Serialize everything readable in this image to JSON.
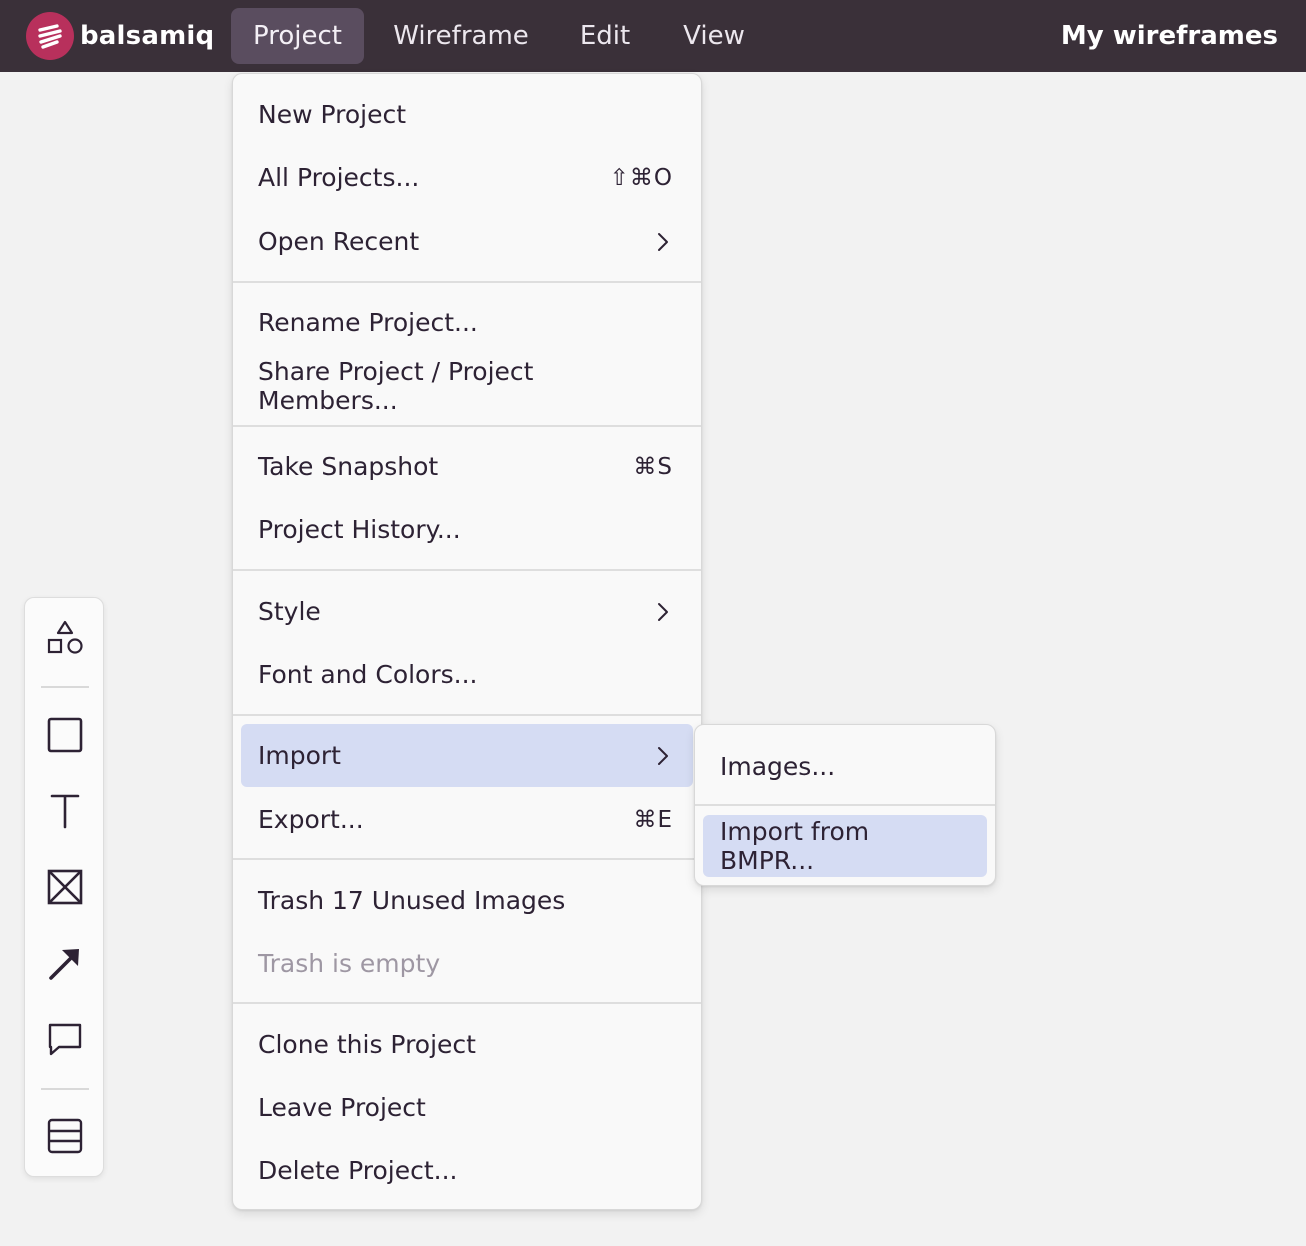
{
  "app": {
    "logo_text": "balsamiq",
    "right_link": "My wireframes"
  },
  "nav": [
    "Project",
    "Wireframe",
    "Edit",
    "View"
  ],
  "project_menu": {
    "new_project": "New Project",
    "all_projects": "All Projects...",
    "all_projects_shortcut": "⇧⌘O",
    "open_recent": "Open Recent",
    "rename_project": "Rename Project...",
    "share_project": "Share Project / Project Members...",
    "take_snapshot": "Take Snapshot",
    "take_snapshot_shortcut": "⌘S",
    "project_history": "Project History...",
    "style": "Style",
    "font_colors": "Font and Colors...",
    "import": "Import",
    "export": "Export...",
    "export_shortcut": "⌘E",
    "trash_unused": "Trash 17 Unused Images",
    "trash_empty": "Trash is empty",
    "clone_project": "Clone this Project",
    "leave_project": "Leave Project",
    "delete_project": "Delete Project..."
  },
  "import_submenu": {
    "images": "Images...",
    "import_bmpr": "Import from BMPR..."
  },
  "colors": {
    "topbar": "#3a3039",
    "highlight": "#d5dcf3",
    "logo": "#b8305c"
  },
  "toolbar_icons": [
    "shapes-icon",
    "rectangle-icon",
    "text-icon",
    "image-placeholder-icon",
    "arrow-icon",
    "comment-icon",
    "layout-icon"
  ]
}
